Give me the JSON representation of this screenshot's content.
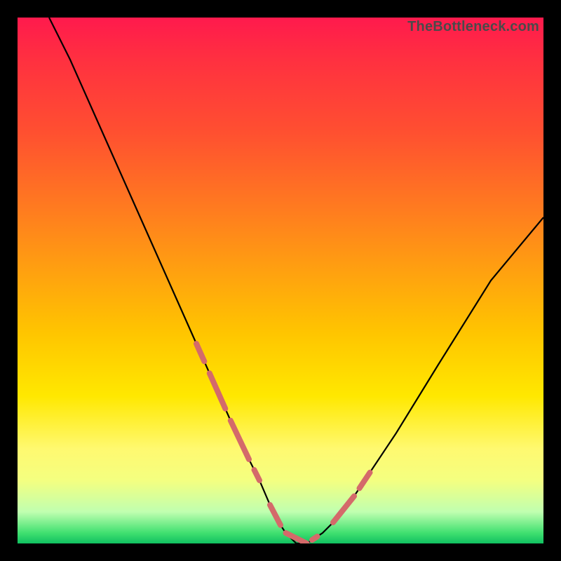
{
  "watermark": "TheBottleneck.com",
  "chart_data": {
    "type": "line",
    "title": "",
    "xlabel": "",
    "ylabel": "",
    "xlim": [
      0,
      100
    ],
    "ylim": [
      0,
      100
    ],
    "grid": false,
    "legend": false,
    "series": [
      {
        "name": "bottleneck-curve",
        "x": [
          6,
          10,
          14,
          18,
          22,
          26,
          30,
          34,
          38,
          42,
          46,
          49,
          51,
          53,
          55,
          58,
          62,
          66,
          72,
          80,
          90,
          100
        ],
        "y": [
          100,
          92,
          83,
          74,
          65,
          56,
          47,
          38,
          29,
          20,
          12,
          5,
          2,
          0,
          0,
          2,
          6,
          12,
          21,
          34,
          50,
          62
        ],
        "color": "#000000"
      }
    ],
    "highlight_band": {
      "y_range": [
        0,
        14
      ],
      "tint": "pale-yellow"
    },
    "dash_markers": {
      "color": "#d46a6a",
      "segments": [
        {
          "x_start": 34,
          "x_end": 35.5
        },
        {
          "x_start": 36.5,
          "x_end": 39.5
        },
        {
          "x_start": 40.5,
          "x_end": 44
        },
        {
          "x_start": 45,
          "x_end": 46
        },
        {
          "x_start": 48,
          "x_end": 50
        },
        {
          "x_start": 51,
          "x_end": 55
        },
        {
          "x_start": 56,
          "x_end": 57
        },
        {
          "x_start": 60,
          "x_end": 64
        },
        {
          "x_start": 65,
          "x_end": 67
        }
      ]
    }
  }
}
